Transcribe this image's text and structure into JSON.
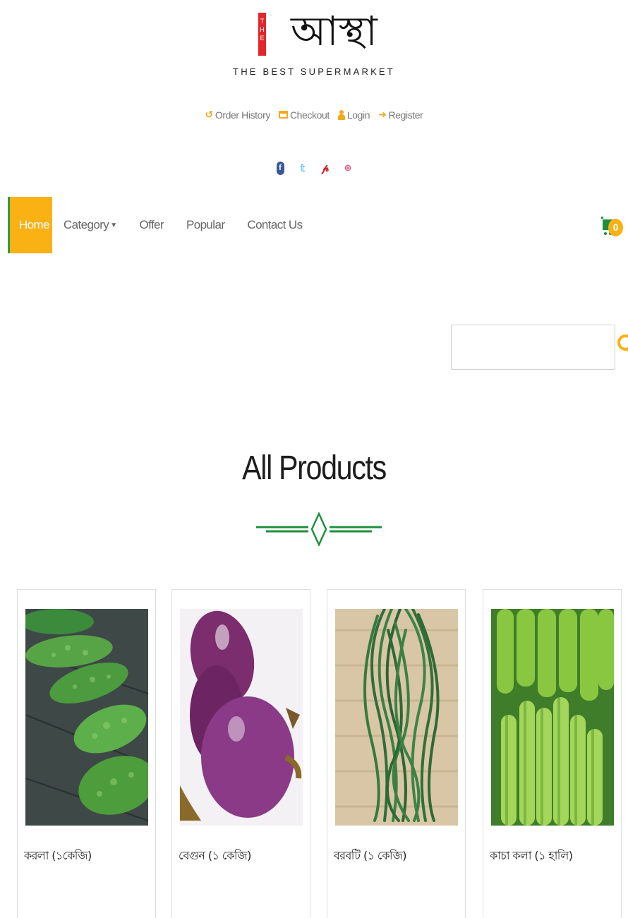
{
  "header": {
    "logo_badge": [
      "T",
      "H",
      "E"
    ],
    "logo_mark": "আস্থা",
    "tagline": "THE BEST SUPERMARKET"
  },
  "top_links": [
    {
      "label": "Order History",
      "icon": "history-icon"
    },
    {
      "label": "Checkout",
      "icon": "checkout-icon"
    },
    {
      "label": "Login",
      "icon": "user-icon"
    },
    {
      "label": "Register",
      "icon": "sign-in-icon"
    }
  ],
  "social": [
    "facebook-icon",
    "twitter-icon",
    "pinterest-icon",
    "dribbble-icon"
  ],
  "nav": {
    "items": [
      {
        "label": "Home",
        "active": true
      },
      {
        "label": "Category",
        "dropdown": true
      },
      {
        "label": "Offer"
      },
      {
        "label": "Popular"
      },
      {
        "label": "Contact Us"
      }
    ],
    "cart_count": "0"
  },
  "search": {
    "value": "",
    "placeholder": ""
  },
  "section_title": "All Products",
  "products": [
    {
      "name": "করলা (১কেজি)"
    },
    {
      "name": "বেগুন (১ কেজি)"
    },
    {
      "name": "বরবটি (১ কেজি)"
    },
    {
      "name": "কাচা কলা (১ হালি)"
    }
  ],
  "colors": {
    "accent": "#f9b113",
    "nav_active_border": "#2e9b47",
    "divider": "#1f8f3f",
    "logo_badge": "#e3262a",
    "facebook": "#3b5998",
    "twitter": "#1da1f2",
    "pinterest": "#cb2027",
    "dribbble": "#ea4c89"
  }
}
